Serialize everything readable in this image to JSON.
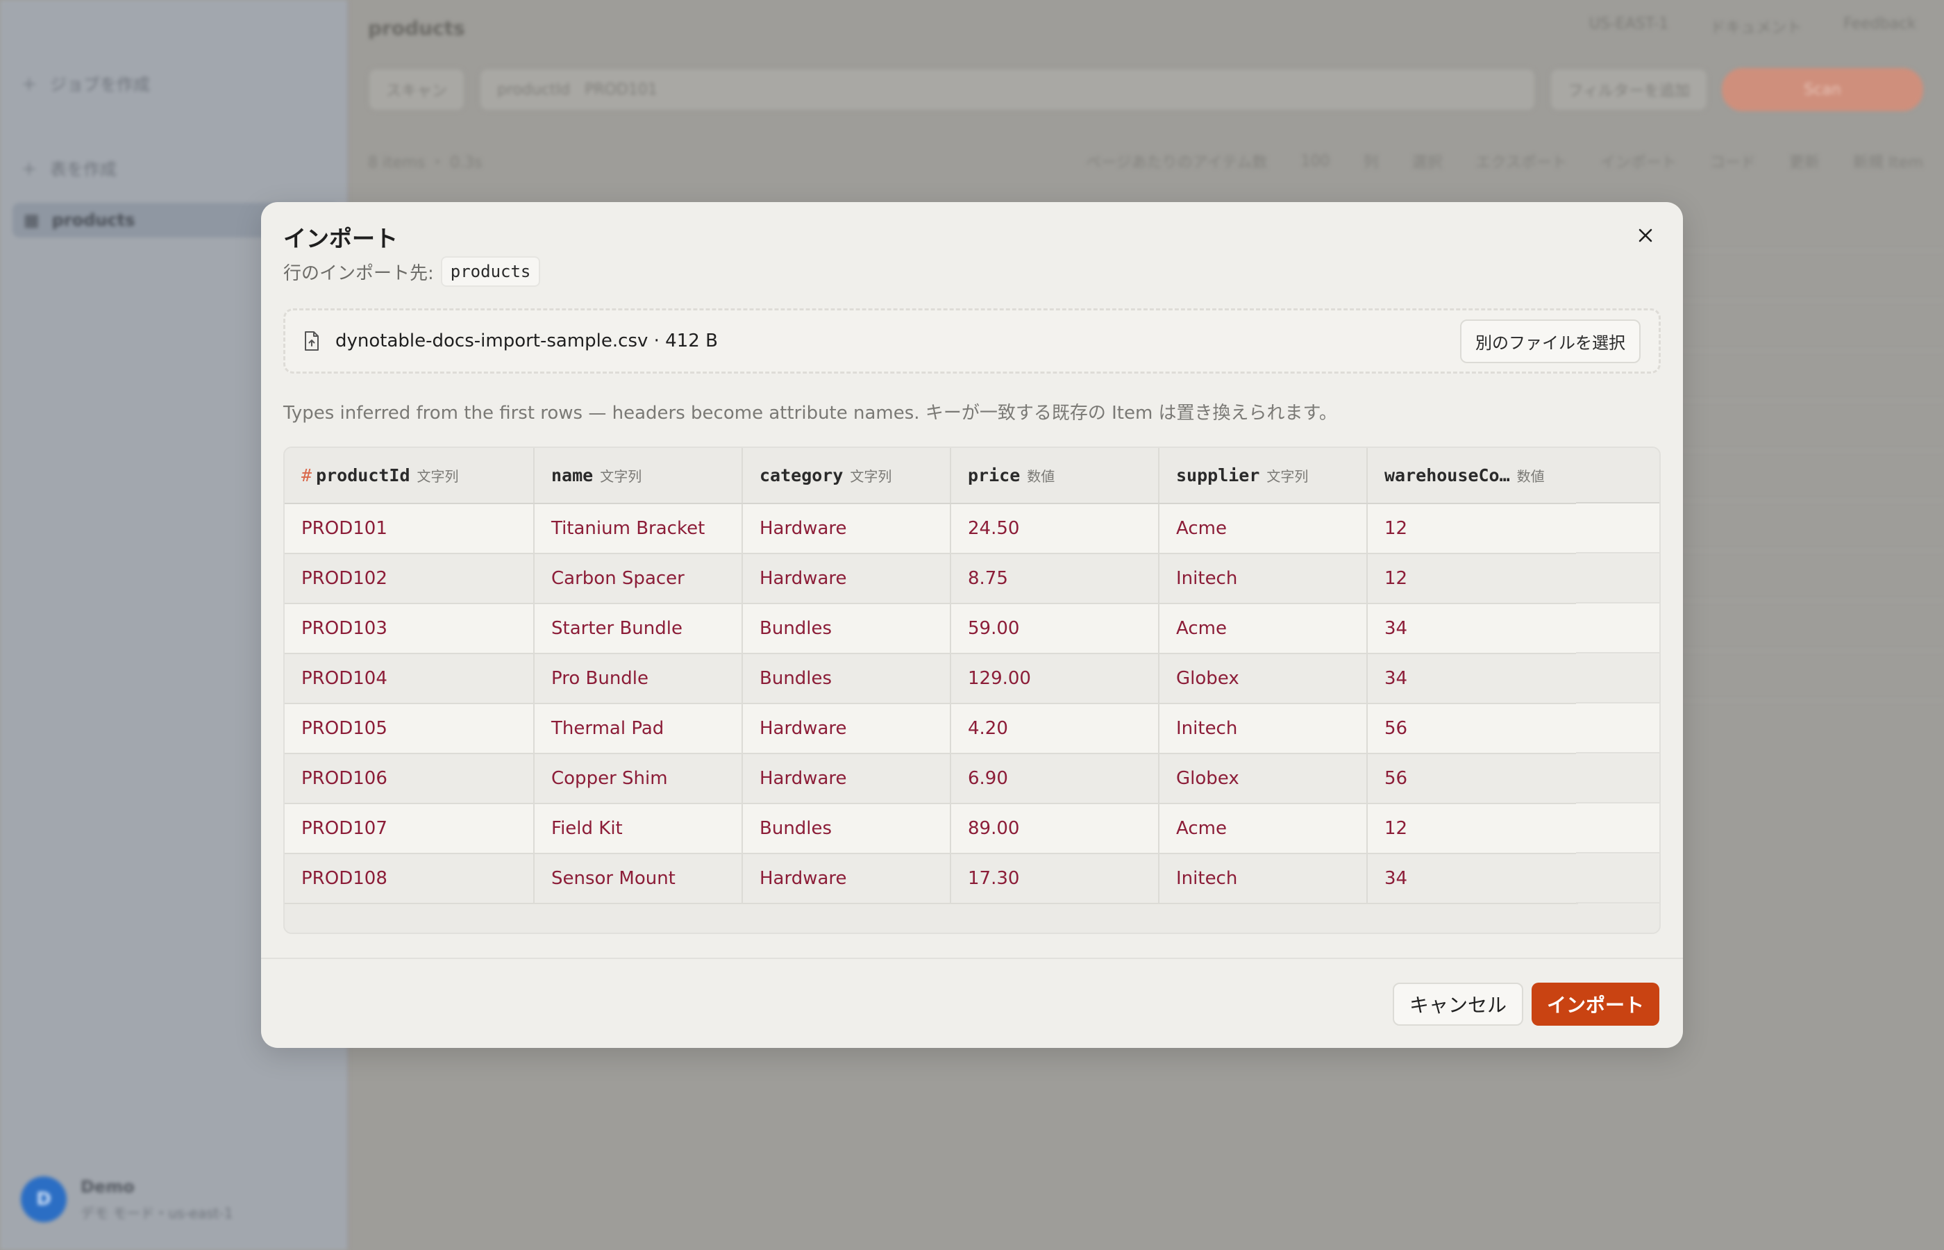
{
  "background": {
    "sidebar": {
      "create_query_label": "ジョブを作成",
      "create_table_label": "表を作成",
      "active_table_label": "products",
      "user": {
        "avatar": "D",
        "name": "Demo",
        "sub": "デモ モード・us-east-1"
      }
    },
    "header": {
      "title": "products",
      "right_items": [
        "US-EAST-1",
        "ドキュメント",
        "Feedback"
      ]
    },
    "toolbar1": {
      "mode_label": "スキャン",
      "pk_label": "productId",
      "query_placeholder": "PROD101",
      "filter_label": "フィルターを追加",
      "run_label": "Scan"
    },
    "toolbar2": {
      "count_label": "8 items ・ 0.3s",
      "page_size_label": "ページあたりのアイテム数",
      "page_size_value": "100",
      "items": [
        "列",
        "選択",
        "エクスポート",
        "インポート",
        "コード",
        "更新",
        "新規 Item"
      ]
    }
  },
  "modal": {
    "title": "インポート",
    "subtitle_prefix": "行のインポート先:",
    "target_table": "products",
    "file": {
      "name": "dynotable-docs-import-sample.csv · 412 B",
      "change_label": "別のファイルを選択"
    },
    "hint": "Types inferred from the first rows — headers become attribute names. キーが一致する既存の Item は置き換えられます。",
    "columns": [
      {
        "name": "productId",
        "type": "文字列",
        "key": "#"
      },
      {
        "name": "name",
        "type": "文字列"
      },
      {
        "name": "category",
        "type": "文字列"
      },
      {
        "name": "price",
        "type": "数値"
      },
      {
        "name": "supplier",
        "type": "文字列"
      },
      {
        "name": "warehouseCo…",
        "type": "数値"
      }
    ],
    "rows": [
      [
        "PROD101",
        "Titanium Bracket",
        "Hardware",
        "24.50",
        "Acme",
        "12"
      ],
      [
        "PROD102",
        "Carbon Spacer",
        "Hardware",
        "8.75",
        "Initech",
        "12"
      ],
      [
        "PROD103",
        "Starter Bundle",
        "Bundles",
        "59.00",
        "Acme",
        "34"
      ],
      [
        "PROD104",
        "Pro Bundle",
        "Bundles",
        "129.00",
        "Globex",
        "34"
      ],
      [
        "PROD105",
        "Thermal Pad",
        "Hardware",
        "4.20",
        "Initech",
        "56"
      ],
      [
        "PROD106",
        "Copper Shim",
        "Hardware",
        "6.90",
        "Globex",
        "56"
      ],
      [
        "PROD107",
        "Field Kit",
        "Bundles",
        "89.00",
        "Acme",
        "12"
      ],
      [
        "PROD108",
        "Sensor Mount",
        "Hardware",
        "17.30",
        "Initech",
        "34"
      ]
    ],
    "cancel_label": "キャンセル",
    "import_label": "インポート"
  },
  "colors": {
    "accent": "#c94312",
    "cell_text": "#8c1d38",
    "key_marker": "#d9684b"
  }
}
